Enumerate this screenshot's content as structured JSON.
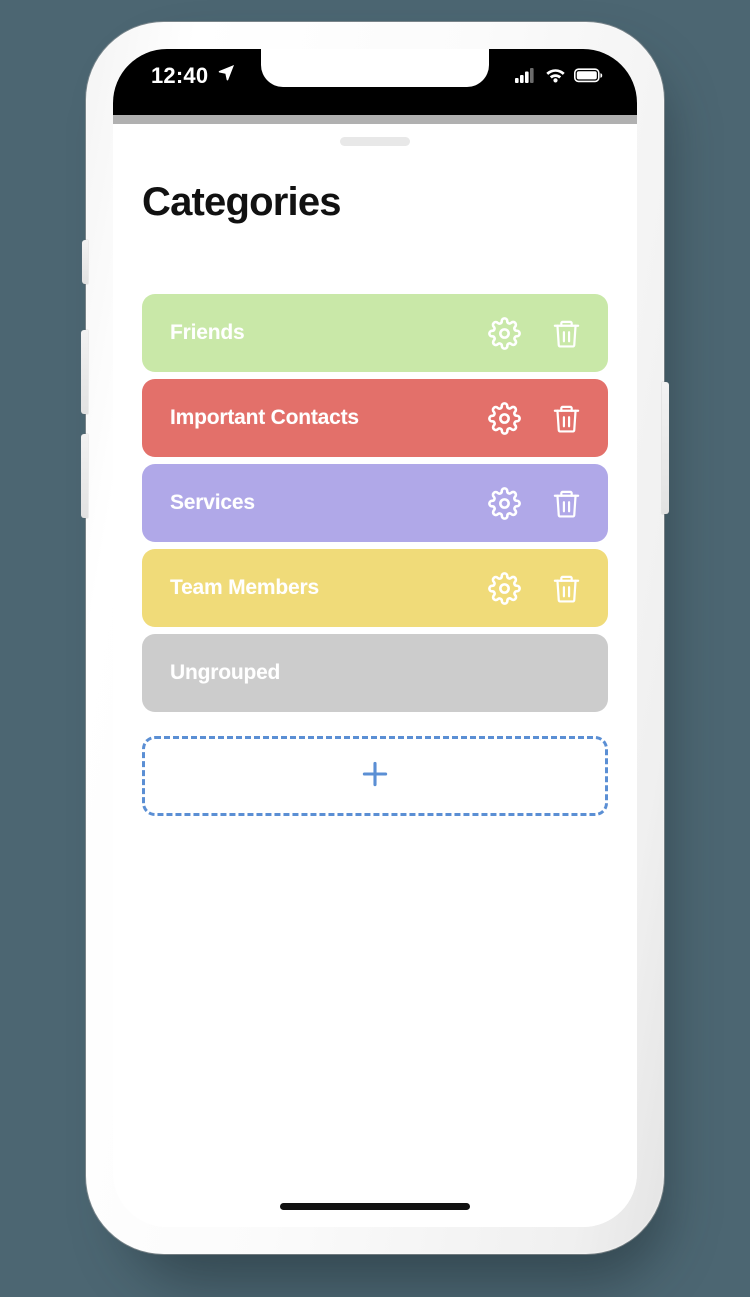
{
  "device": {
    "type": "smartphone-mockup",
    "frame_color": "#f4f4f4",
    "background_color": "#4c6672"
  },
  "status_bar": {
    "time": "12:40",
    "location_icon": "location-arrow-icon",
    "cellular_icon": "signal-bars-icon",
    "cellular_bars_filled": 3,
    "cellular_bars_total": 4,
    "wifi_icon": "wifi-icon",
    "battery_icon": "battery-icon",
    "battery_level_percent": 92,
    "foreground_color": "#ffffff",
    "background_color": "#000000"
  },
  "app": {
    "sheet_handle": "drag-handle",
    "page_title": "Categories",
    "background_color": "#ffffff"
  },
  "categories": [
    {
      "label": "Friends",
      "color": "#c9e8a8",
      "has_actions": true,
      "settings_icon": "gear-icon",
      "delete_icon": "trash-icon"
    },
    {
      "label": "Important Contacts",
      "color": "#e3706a",
      "has_actions": true,
      "settings_icon": "gear-icon",
      "delete_icon": "trash-icon"
    },
    {
      "label": "Services",
      "color": "#b0a8e8",
      "has_actions": true,
      "settings_icon": "gear-icon",
      "delete_icon": "trash-icon"
    },
    {
      "label": "Team Members",
      "color": "#f0db79",
      "has_actions": true,
      "settings_icon": "gear-icon",
      "delete_icon": "trash-icon"
    },
    {
      "label": "Ungrouped",
      "color": "#cccccc",
      "has_actions": false,
      "settings_icon": null,
      "delete_icon": null
    }
  ],
  "add_button": {
    "icon": "plus-icon",
    "accent_color": "#5b8fd4",
    "border_style": "dashed"
  },
  "home_indicator": {
    "color": "#111111"
  }
}
